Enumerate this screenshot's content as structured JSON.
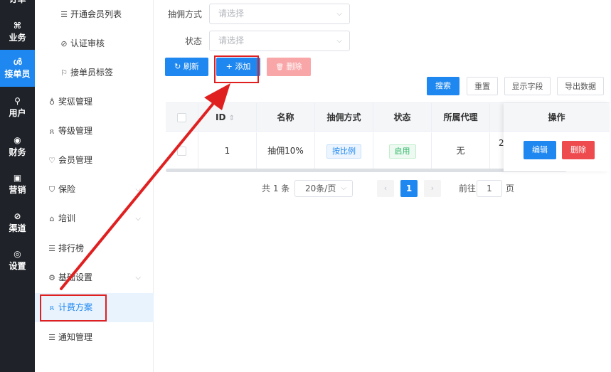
{
  "rail": {
    "top_label": "订单",
    "items": [
      {
        "icon": "⌘",
        "label": "业务"
      },
      {
        "icon": "ൾ",
        "label": "接单员"
      },
      {
        "icon": "⚲",
        "label": "用户"
      },
      {
        "icon": "◉",
        "label": "财务"
      },
      {
        "icon": "▣",
        "label": "营销"
      },
      {
        "icon": "⊘",
        "label": "渠道"
      },
      {
        "icon": "◎",
        "label": "设置"
      }
    ]
  },
  "sidebar": {
    "items": [
      {
        "icon": "☰",
        "label": "开通会员列表"
      },
      {
        "icon": "⊘",
        "label": "认证审核"
      },
      {
        "icon": "⚐",
        "label": "接单员标签"
      },
      {
        "icon": "♁",
        "label": "奖惩管理"
      },
      {
        "icon": "ጸ",
        "label": "等级管理"
      },
      {
        "icon": "♡",
        "label": "会员管理"
      },
      {
        "icon": "⛉",
        "label": "保险",
        "caret": "⌵"
      },
      {
        "icon": "⌂",
        "label": "培训",
        "caret": "⌵"
      },
      {
        "icon": "☰",
        "label": "排行榜"
      },
      {
        "icon": "⚙",
        "label": "基础设置",
        "caret": "⌵"
      },
      {
        "icon": "ጸ",
        "label": "计费方案"
      },
      {
        "icon": "☰",
        "label": "通知管理"
      }
    ]
  },
  "filters": {
    "commission_label": "抽佣方式",
    "commission_placeholder": "请选择",
    "status_label": "状态",
    "status_placeholder": "请选择",
    "arrow": "⌵"
  },
  "toolbar": {
    "refresh_icon": "↻",
    "refresh": "刷新",
    "add_icon": "+",
    "add": "添加",
    "delete_icon": "🗑",
    "delete": "删除",
    "search": "搜索",
    "reset": "重置",
    "show_fields": "显示字段",
    "export": "导出数据"
  },
  "table": {
    "headers": {
      "id": "ID",
      "sort_icon": "⇕",
      "name": "名称",
      "commission": "抽佣方式",
      "status": "状态",
      "agent": "所属代理",
      "actions": "操作"
    },
    "rows": [
      {
        "id": "1",
        "name": "抽佣10%",
        "commission": "按比例",
        "status": "启用",
        "agent": "无",
        "overflow": "2",
        "edit": "编辑",
        "delete": "删除"
      }
    ]
  },
  "pagination": {
    "total": "共 1 条",
    "page_size": "20条/页",
    "size_arrow": "⌵",
    "prev": "‹",
    "current": "1",
    "next": "›",
    "goto_prefix": "前往",
    "goto_value": "1",
    "goto_suffix": "页"
  },
  "colors": {
    "primary": "#1e87f0",
    "danger": "#ee4b4f",
    "annotation": "#e02020",
    "rail_bg": "#1f2329"
  }
}
